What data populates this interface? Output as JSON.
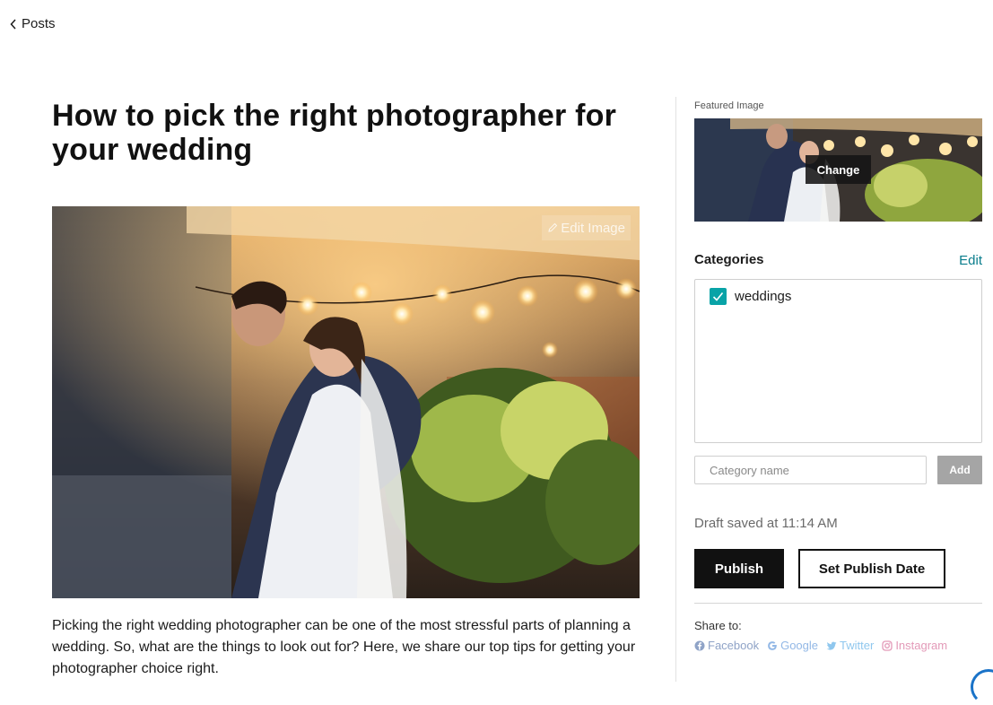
{
  "nav": {
    "back_label": "Posts"
  },
  "post": {
    "title": "How to pick the right photographer for your wedding",
    "edit_image_label": "Edit Image",
    "body": "Picking the right wedding photographer can be one of the most stressful parts of planning a wedding. So, what are the things to look out for? Here, we share our top tips for getting your photographer choice right."
  },
  "sidebar": {
    "featured_image_label": "Featured Image",
    "change_label": "Change",
    "categories": {
      "heading": "Categories",
      "edit_label": "Edit",
      "items": [
        {
          "label": "weddings",
          "checked": true
        }
      ],
      "input_placeholder": "Category name",
      "add_label": "Add"
    },
    "draft_status": "Draft saved at 11:14 AM",
    "publish_label": "Publish",
    "set_publish_date_label": "Set Publish Date",
    "share": {
      "label": "Share to:",
      "links": [
        {
          "name": "Facebook",
          "icon": "facebook-icon",
          "color": "#8fa3c7"
        },
        {
          "name": "Google",
          "icon": "google-icon",
          "color": "#93b8e6"
        },
        {
          "name": "Twitter",
          "icon": "twitter-icon",
          "color": "#8fc7ee"
        },
        {
          "name": "Instagram",
          "icon": "instagram-icon",
          "color": "#e39ab8"
        }
      ]
    }
  },
  "colors": {
    "accent_teal": "#09a3a7",
    "link_teal": "#0a7d8c",
    "primary_button": "#111111",
    "disabled_button": "#a5a5a5"
  }
}
